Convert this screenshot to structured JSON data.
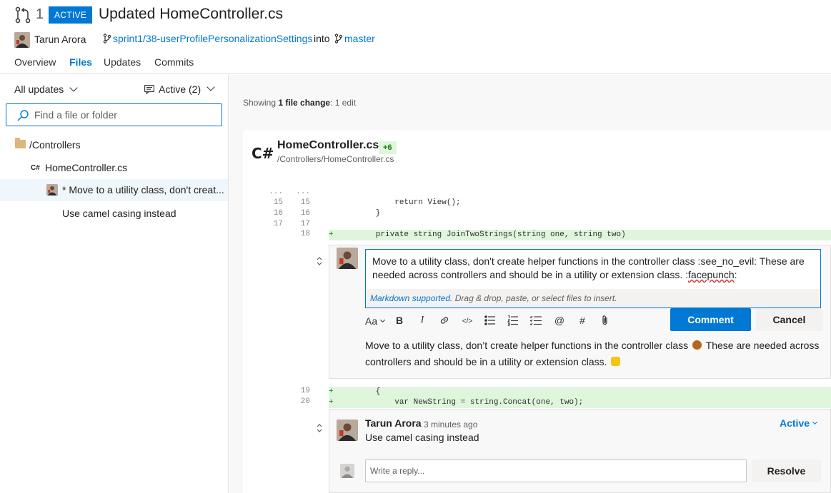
{
  "header": {
    "pr_id": "1",
    "status": "ACTIVE",
    "title": "Updated HomeController.cs",
    "author": "Tarun Arora",
    "source_branch": "sprint1/38-userProfilePersonalizationSettings",
    "into": "into",
    "target_branch": "master",
    "tabs": [
      "Overview",
      "Files",
      "Updates",
      "Commits"
    ],
    "selected_tab": "Files"
  },
  "sidebar": {
    "updates_filter": "All updates",
    "comments_filter": "Active (2)",
    "search_placeholder": "Find a file or folder",
    "folder": "/Controllers",
    "file_badge": "C#",
    "file": "HomeController.cs",
    "threads": [
      "* Move to a utility class, don't creat...",
      "Use camel casing instead"
    ]
  },
  "main": {
    "summary_prefix": "Showing ",
    "summary_bold": "1 file change",
    "summary_suffix": ":   1 edit",
    "file": {
      "lang_badge": "C#",
      "name": "HomeController.cs",
      "change": "+6",
      "path": "/Controllers/HomeController.cs"
    },
    "code": {
      "ellipsis": "...",
      "lines": [
        {
          "left": "15",
          "right": "15",
          "text": "            return View();"
        },
        {
          "left": "16",
          "right": "16",
          "text": "        }"
        },
        {
          "left": "17",
          "right": "17",
          "text": ""
        }
      ],
      "added": [
        {
          "right": "18",
          "mark": "+",
          "text": "        private string JoinTwoStrings(string one, string two)"
        },
        {
          "right": "19",
          "mark": "+",
          "text": "        {"
        },
        {
          "right": "20",
          "mark": "+",
          "text": "            var NewString = string.Concat(one, two);"
        }
      ]
    },
    "editor": {
      "text_a": "Move to a utility class, don't create helper functions in the controller class :see_no_evil: These are needed across controllers and should be in a utility or extension class. :",
      "text_squiggle": "facepunch",
      "text_b": ":",
      "hint_link": "Markdown supported.",
      "hint_text": " Drag & drop, paste, or select files to insert.",
      "toolbar": {
        "format": "Aa",
        "bold": "B",
        "italic": "I",
        "link": "🔗",
        "code": "</>",
        "mention": "@",
        "hash": "#",
        "attach": "📎"
      },
      "comment_label": "Comment",
      "cancel_label": "Cancel",
      "preview_a": "Move to a utility class, don’t create helper functions in the controller class",
      "preview_b": "These are needed across controllers and should be in a utility or extension class."
    },
    "thread": {
      "author": "Tarun Arora",
      "time": "3 minutes ago",
      "status": "Active",
      "body": "Use camel casing instead",
      "reply_placeholder": "Write a reply...",
      "resolve_label": "Resolve"
    }
  },
  "colors": {
    "accent": "#0078d4",
    "added_bg": "#dff6dd",
    "added_text": "#107c10"
  },
  "icons": [
    "pull-request-icon",
    "branch-icon",
    "search-icon",
    "folder-icon",
    "comment-icon",
    "chevron-down-icon",
    "collapse-icon"
  ]
}
